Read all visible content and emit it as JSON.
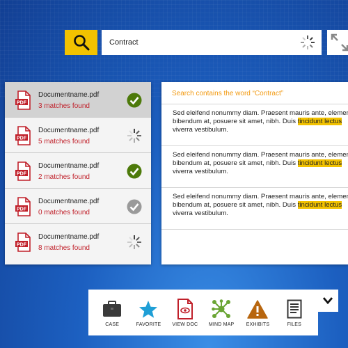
{
  "search": {
    "value": "Contract"
  },
  "files": [
    {
      "name": "Documentname.pdf",
      "matches": "3 matches found",
      "status": "done",
      "selected": true
    },
    {
      "name": "Documentname.pdf",
      "matches": "5 matches found",
      "status": "loading",
      "selected": false
    },
    {
      "name": "Documentname.pdf",
      "matches": "2 matches found",
      "status": "done",
      "selected": false
    },
    {
      "name": "Documentname.pdf",
      "matches": "0 matches found",
      "status": "inactive",
      "selected": false
    },
    {
      "name": "Documentname.pdf",
      "matches": "8 matches found",
      "status": "loading",
      "selected": false
    }
  ],
  "pdf_badge": "PDF",
  "results": {
    "header": "Search contains the word “Contract”",
    "snippets": [
      {
        "line1": "Sed eleifend nonummy diam. Praesent mauris ante, elementum",
        "line2_pre": "bibendum at, posuere sit amet, nibh. Duis ",
        "line2_hl": "tincidunt lectus",
        "line3": "viverra vestibulum."
      },
      {
        "line1": "Sed eleifend nonummy diam. Praesent mauris ante, elementum",
        "line2_pre": "bibendum at, posuere sit amet, nibh. Duis ",
        "line2_hl": "tincidunt lectus",
        "line3": "viverra vestibulum."
      },
      {
        "line1": "Sed eleifend nonummy diam. Praesent mauris ante, elementum",
        "line2_pre": "bibendum at, posuere sit amet, nibh. Duis ",
        "line2_hl": "tincidunt lectus",
        "line3": "viverra vestibulum."
      }
    ]
  },
  "toolbar": {
    "case": "CASE",
    "favorite": "FAVORITE",
    "view_doc": "VIEW DOC",
    "mind_map": "MIND MAP",
    "exhibits": "EXHIBITS",
    "files": "FILES"
  },
  "colors": {
    "accent_yellow": "#f2c200",
    "match_red": "#c0202a",
    "header_orange": "#f29a12",
    "check_green": "#4d7a0a",
    "star_blue": "#1f9fd6",
    "mindmap_green": "#6aa534",
    "exhibit_brown": "#b8660f"
  }
}
